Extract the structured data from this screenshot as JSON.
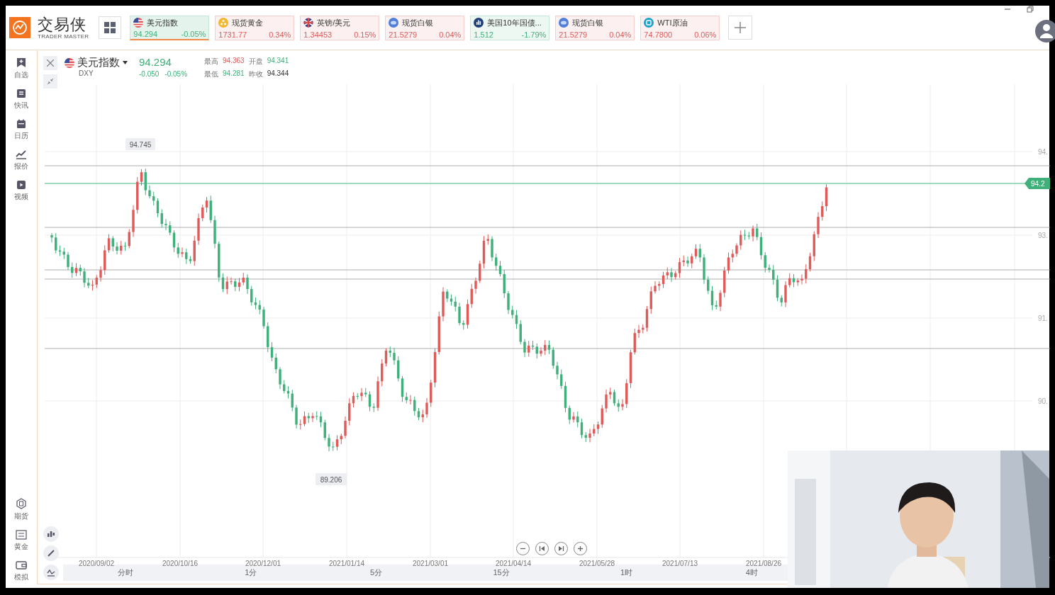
{
  "app": {
    "logo_text": "交易侠",
    "logo_subtitle": "TRADER MASTER"
  },
  "tickers": [
    {
      "kind": "us-flag",
      "name": "美元指数",
      "price": "94.294",
      "change": "-0.05%",
      "color": "#3fb07a",
      "selected": true
    },
    {
      "kind": "gold",
      "name": "现货黄金",
      "price": "1731.77",
      "change": "0.34%",
      "color": "#e05a5a",
      "selected": false
    },
    {
      "kind": "uk-flag",
      "name": "英镑/美元",
      "price": "1.34453",
      "change": "0.15%",
      "color": "#e05a5a",
      "selected": false
    },
    {
      "kind": "silver",
      "name": "现货白银",
      "price": "21.5279",
      "change": "0.04%",
      "color": "#e05a5a",
      "selected": false
    },
    {
      "kind": "bond",
      "name": "美国10年国债...",
      "price": "1.512",
      "change": "-1.79%",
      "color": "#3fb07a",
      "selected": false
    },
    {
      "kind": "silver",
      "name": "现货白银",
      "price": "21.5279",
      "change": "0.04%",
      "color": "#e05a5a",
      "selected": false
    },
    {
      "kind": "oil",
      "name": "WTI原油",
      "price": "74.7800",
      "change": "0.06%",
      "color": "#e05a5a",
      "selected": false
    }
  ],
  "sidebar": {
    "top_items": [
      {
        "kind": "bookmark",
        "label": "自选"
      },
      {
        "kind": "news",
        "label": "快讯"
      },
      {
        "kind": "calendar",
        "label": "日历"
      },
      {
        "kind": "quote",
        "label": "报价"
      },
      {
        "kind": "video",
        "label": "视频"
      }
    ],
    "bottom_items": [
      {
        "kind": "futures",
        "label": "期货"
      },
      {
        "kind": "gold",
        "label": "黄金"
      },
      {
        "kind": "wallet",
        "label": "模拟"
      }
    ]
  },
  "quote": {
    "name": "美元指数",
    "code": "DXY",
    "price": "94.294",
    "change": "-0.050",
    "change_pct": "-0.05%",
    "stats": [
      {
        "label": "最高",
        "value": "94.363",
        "color": "#e05a5a"
      },
      {
        "label": "开盘",
        "value": "94.341",
        "color": "#3fb07a"
      },
      {
        "label": "最低",
        "value": "94.281",
        "color": "#3fb07a"
      },
      {
        "label": "昨收",
        "value": "94.344",
        "color": "#333333"
      }
    ]
  },
  "chart": {
    "high_label": "94.745",
    "low_label": "89.206",
    "current_price_label": "94.2",
    "y_ticks": [
      "94.",
      "93.",
      "91.",
      "90."
    ],
    "dates": [
      "2020/09/02",
      "2020/10/16",
      "2020/12/01",
      "2021/01/14",
      "2021/03/01",
      "2021/04/14",
      "2021/05/28",
      "2021/07/13",
      "2021/08/26"
    ],
    "periods": [
      "分时",
      "1分",
      "5分",
      "15分",
      "1时",
      "4时"
    ]
  }
}
